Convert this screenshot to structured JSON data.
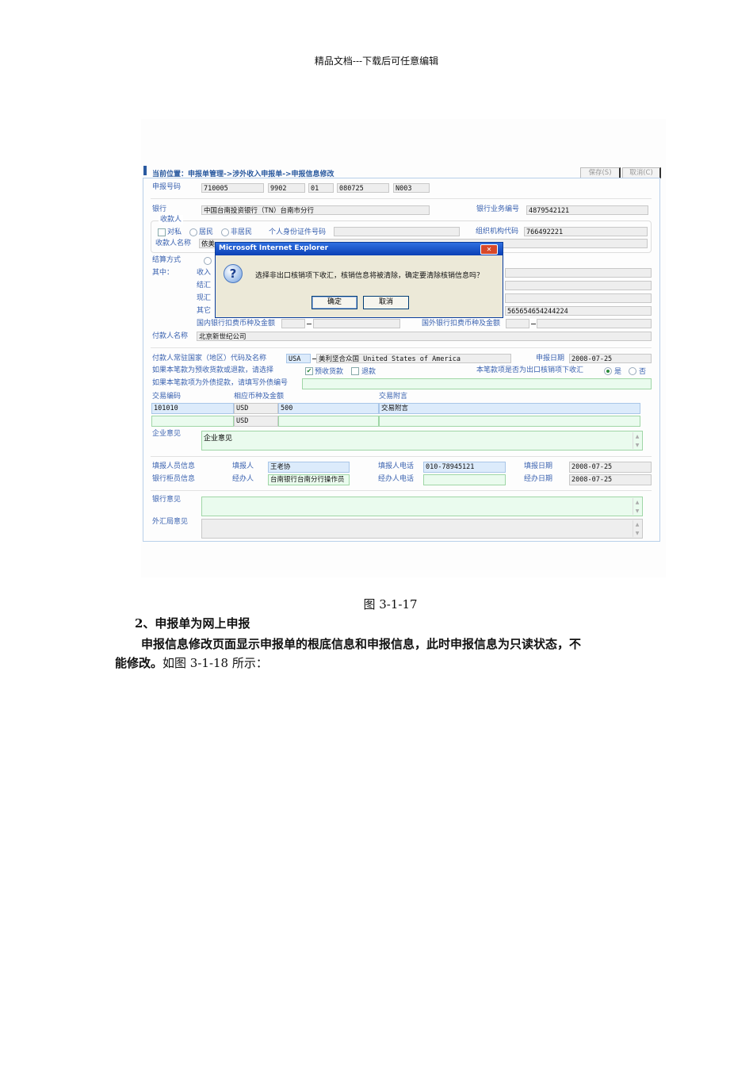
{
  "doc": {
    "header": "精品文档---下载后可任意编辑",
    "caption": "图 3-1-17",
    "section_title": "2、申报单为网上申报",
    "para_line1": "申报信息修改页面显示申报单的根底信息和申报信息，此时申报信息为只读状态，不",
    "para_line2_bold": "能修改。",
    "para_line2_normal": "如图 3-1-18 所示："
  },
  "app": {
    "breadcrumb": "当前位置：申报单管理->涉外收入申报单->申报信息修改",
    "save_label": "保存(S)",
    "cancel_label": "取消(C)",
    "report_no_label": "申报号码",
    "report_no": [
      "710005",
      "9902",
      "01",
      "080725",
      "N003"
    ],
    "bank_label": "银行",
    "bank": "中国台南投资银行（TN）台南市分行",
    "bank_biz_no_label": "银行业务编号",
    "bank_biz_no": "4879542121",
    "payee_legend": "收款人",
    "private_label": "对私",
    "resident_label": "居民",
    "nonresident_label": "非居民",
    "id_label": "个人身份证件号码",
    "org_code_label": "组织机构代码",
    "org_code": "766492221",
    "payee_name_label": "收款人名称",
    "payee_name": "依美",
    "settle_label": "结算方式",
    "among_label": "其中：",
    "among_items": [
      "收入",
      "结汇",
      "现汇",
      "其它"
    ],
    "other_account": "565654654244224",
    "dom_fee_label": "国内银行扣费币种及金额",
    "for_fee_label": "国外银行扣费币种及金额",
    "payer_name_label": "付款人名称",
    "payer_name": "北京新世纪公司",
    "country_label": "付款人常驻国家（地区）代码及名称",
    "country_code": "USA",
    "country_name": "美利坚合众国 United States of America",
    "report_date_label": "申报日期",
    "report_date": "2008-07-25",
    "prepay_q": "如果本笔款为预收货款或退款，请选择",
    "prepay_label": "预收货款",
    "refund_label": "退款",
    "export_q": "本笔款项是否为出口核销项下收汇",
    "yes_label": "是",
    "no_label": "否",
    "debt_q": "如果本笔款项为外债提款，请填写外债编号",
    "tx_code_label": "交易编码",
    "tx_amount_label": "相应币种及金额",
    "tx_note_label": "交易附言",
    "tx_rows": [
      {
        "code": "101010",
        "currency": "USD",
        "amount": "500",
        "note": "交易附言"
      },
      {
        "code": "",
        "currency": "USD",
        "amount": "",
        "note": ""
      }
    ],
    "corp_opinion_label": "企业意见",
    "corp_opinion": "企业意见",
    "filler_info_label": "填报人员信息",
    "filler_label": "填报人",
    "filler": "王老协",
    "filler_phone_label": "填报人电话",
    "filler_phone": "010-78945121",
    "fill_date_label": "填报日期",
    "fill_date": "2008-07-25",
    "clerk_info_label": "银行柜员信息",
    "handler_label": "经办人",
    "handler": "台南银行台南分行操作员",
    "handler_phone_label": "经办人电话",
    "handle_date_label": "经办日期",
    "handle_date": "2008-07-25",
    "bank_opinion_label": "银行意见",
    "safe_opinion_label": "外汇局意见"
  },
  "dialog": {
    "title": "Microsoft Internet Explorer",
    "message": "选择非出口核销项下收汇，核销信息将被清除，确定要清除核销信息吗？",
    "ok_label": "确定",
    "cancel_label": "取消"
  }
}
